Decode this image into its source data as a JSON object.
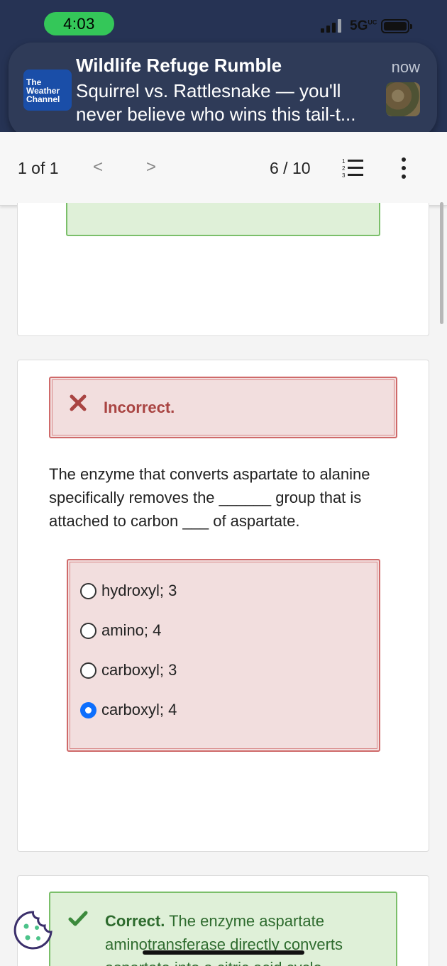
{
  "status_bar": {
    "time": "4:03",
    "network": "5G",
    "network_sup": "UC"
  },
  "notification": {
    "app": "The Weather Channel",
    "logo_lines": [
      "The",
      "Weather",
      "Channel"
    ],
    "title": "Wildlife Refuge Rumble",
    "time": "now",
    "body": "Squirrel vs. Rattlesnake — you'll never believe who wins this tail-t..."
  },
  "toolbar": {
    "count": "1 of 1",
    "prev": "<",
    "next": ">",
    "page": "6 / 10"
  },
  "feedback_incorrect": {
    "label": "Incorrect."
  },
  "question": {
    "part1": "The enzyme that converts aspartate to alanine specifically removes the",
    "blank1": "______",
    "part2": "group that is attached to carbon",
    "blank2": "___",
    "part3": "of aspartate."
  },
  "options": [
    {
      "label": "hydroxyl; 3",
      "selected": false
    },
    {
      "label": "amino; 4",
      "selected": false
    },
    {
      "label": "carboxyl; 3",
      "selected": false
    },
    {
      "label": "carboxyl; 4",
      "selected": true
    }
  ],
  "feedback_correct": {
    "label": "Correct.",
    "text": "The enzyme aspartate aminotransferase directly converts aspartate into a citric acid cycle"
  },
  "colors": {
    "accent": "#0d6efd",
    "incorrect": "#a94442",
    "correct": "#2e6b2e"
  }
}
